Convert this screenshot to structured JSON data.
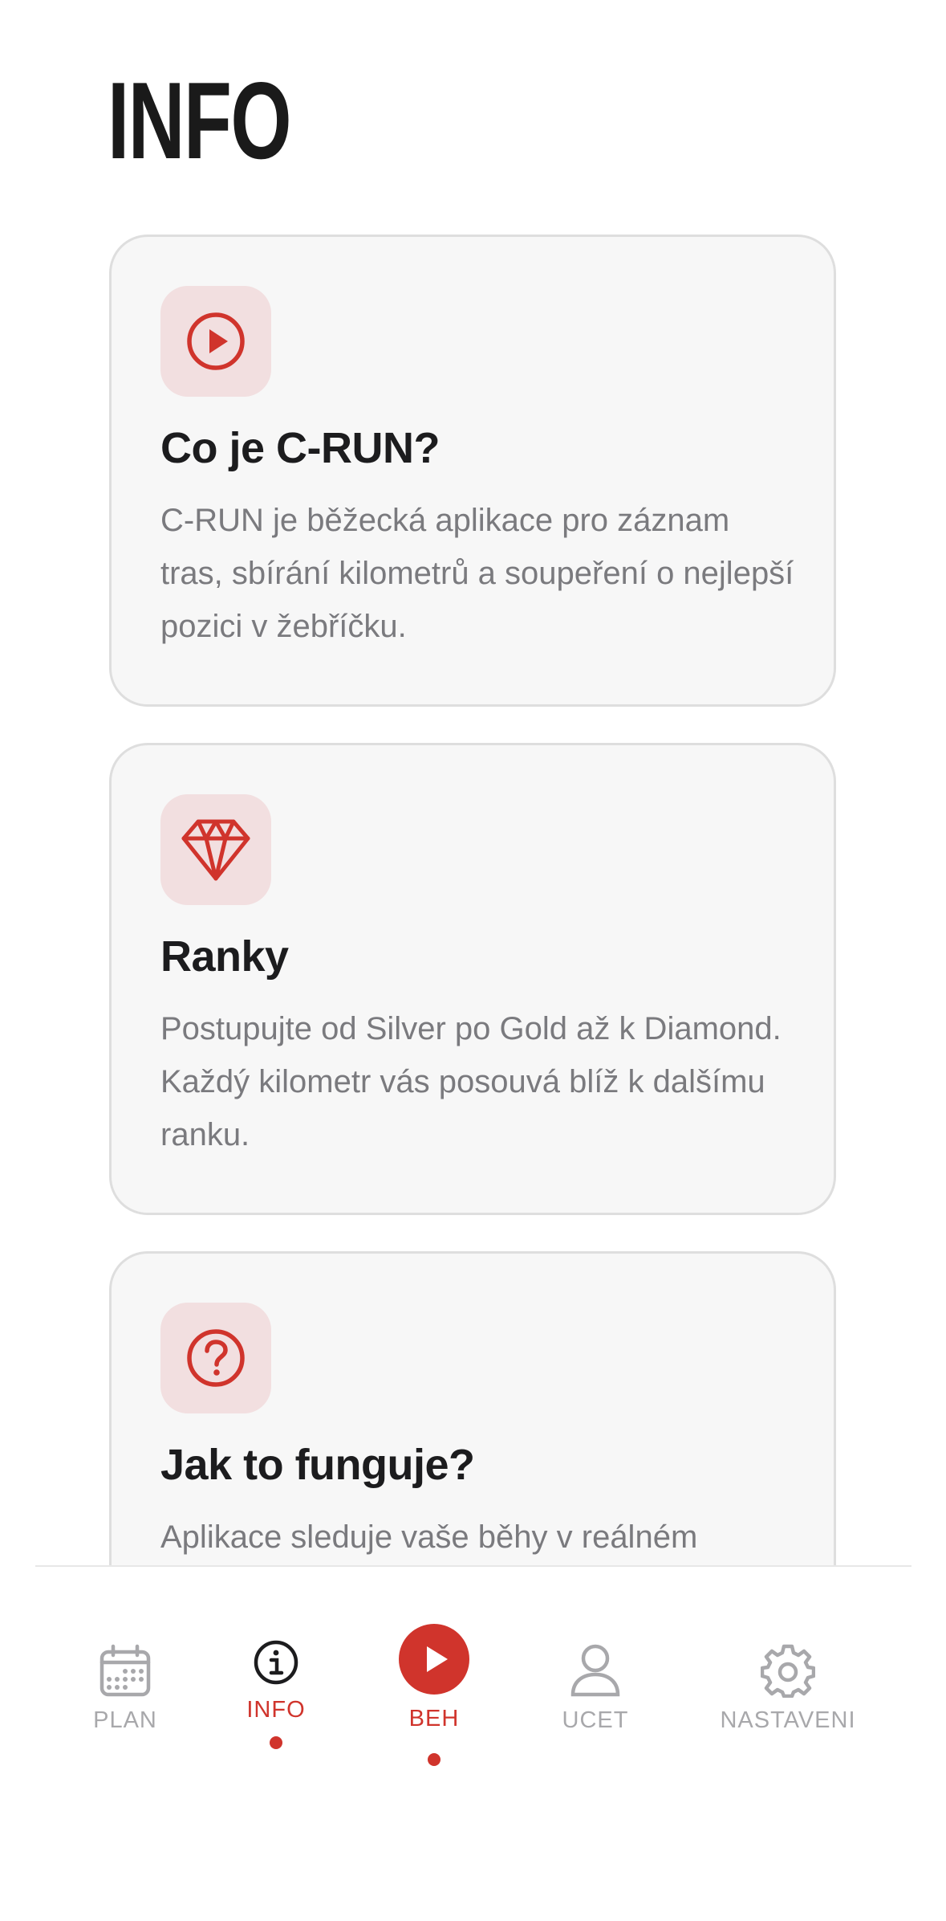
{
  "page": {
    "title": "INFO"
  },
  "cards": [
    {
      "icon": "play-circle-icon",
      "title": "Co je C-RUN?",
      "text": "C-RUN je běžecká aplikace pro záznam tras, sbírání kilometrů a soupeření o nejlepší pozici v žebříčku."
    },
    {
      "icon": "diamond-icon",
      "title": "Ranky",
      "text": "Postupujte od Silver po Gold až k Diamond. Každý kilometr vás posouvá blíž k dalšímu ranku."
    },
    {
      "icon": "question-circle-icon",
      "title": "Jak to funguje?",
      "text": "Aplikace sleduje vaše běhy v reálném"
    }
  ],
  "tabbar": {
    "active": "INFO",
    "tabs": [
      {
        "label": "PLAN",
        "icon": "calendar-icon"
      },
      {
        "label": "INFO",
        "icon": "info-circle-icon"
      },
      {
        "label": "BEH",
        "icon": "play-button-icon"
      },
      {
        "label": "UCET",
        "icon": "user-icon"
      },
      {
        "label": "NASTAVENI",
        "icon": "gear-icon"
      }
    ]
  },
  "colors": {
    "accent": "#d0342c",
    "icon_tile_bg": "#f2dfe0",
    "card_bg": "#f7f7f7",
    "card_border": "#dedede",
    "text_primary": "#1c1c1e",
    "text_secondary": "#7a7a7e",
    "tab_inactive": "#a8a8ab"
  }
}
